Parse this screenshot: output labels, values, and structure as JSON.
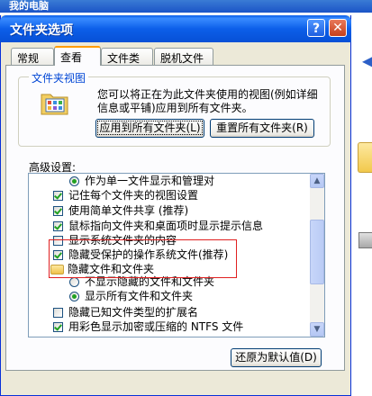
{
  "background_window": {
    "title": "我的电脑"
  },
  "window": {
    "title": "文件夹选项",
    "help_label": "?",
    "close_label": "✕"
  },
  "tabs": [
    {
      "label": "常规",
      "active": false
    },
    {
      "label": "查看",
      "active": true
    },
    {
      "label": "文件类型",
      "active": false
    },
    {
      "label": "脱机文件",
      "active": false
    }
  ],
  "folder_views": {
    "group_title": "文件夹视图",
    "description": "您可以将正在为此文件夹使用的视图(例如详细信息或平铺)应用到所有文件夹。",
    "apply_all_label": "应用到所有文件夹(L)",
    "reset_all_label": "重置所有文件夹(R)"
  },
  "advanced": {
    "label": "高级设置:",
    "items": [
      {
        "type": "radio",
        "checked": true,
        "label": "作为单一文件显示和管理对"
      },
      {
        "type": "checkbox",
        "checked": true,
        "label": "记住每个文件夹的视图设置"
      },
      {
        "type": "checkbox",
        "checked": true,
        "label": "使用简单文件共享 (推荐)"
      },
      {
        "type": "checkbox",
        "checked": true,
        "label": "鼠标指向文件夹和桌面项时显示提示信息"
      },
      {
        "type": "checkbox",
        "checked": false,
        "label": "显示系统文件夹的内容"
      },
      {
        "type": "checkbox",
        "checked": true,
        "label": "隐藏受保护的操作系统文件(推荐)"
      },
      {
        "type": "folder",
        "checked": false,
        "label": "隐藏文件和文件夹"
      },
      {
        "type": "radio",
        "checked": false,
        "label": "不显示隐藏的文件和文件夹"
      },
      {
        "type": "radio",
        "checked": true,
        "label": "显示所有文件和文件夹"
      },
      {
        "type": "checkbox",
        "checked": false,
        "label": "隐藏已知文件类型的扩展名"
      },
      {
        "type": "checkbox",
        "checked": true,
        "label": "用彩色显示加密或压缩的 NTFS 文件"
      }
    ],
    "restore_label": "还原为默认值(D)"
  },
  "colors": {
    "title_blue": "#0c5fe9",
    "highlight_red": "#e02020",
    "check_green": "#21a121"
  }
}
